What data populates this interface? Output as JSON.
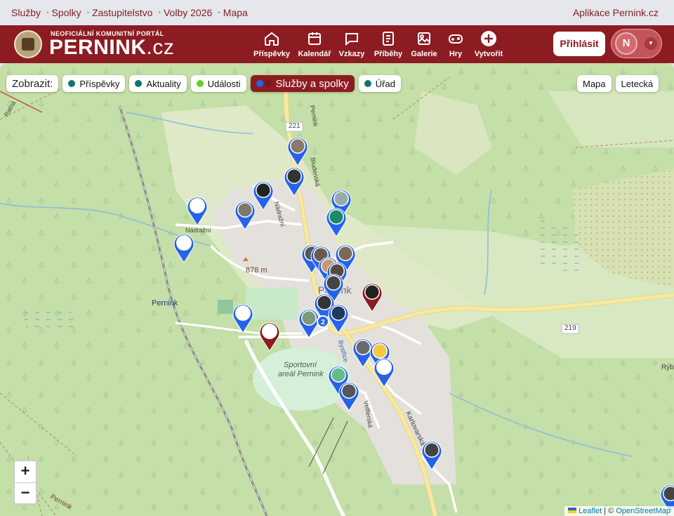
{
  "topnav": {
    "items": [
      "Služby",
      "Spolky",
      "Zastupitelstvo",
      "Volby 2026",
      "Mapa"
    ],
    "app_link": "Aplikace Pernink.cz"
  },
  "header": {
    "logo_sub": "NEOFICIÁLNÍ KOMUNITNÍ PORTÁL",
    "logo_name": "PERNINK",
    "logo_tld": ".cz",
    "nav": [
      {
        "label": "Příspěvky",
        "icon": "home-icon"
      },
      {
        "label": "Kalendář",
        "icon": "calendar-icon"
      },
      {
        "label": "Vzkazy",
        "icon": "chat-bubble-icon"
      },
      {
        "label": "Příběhy",
        "icon": "book-icon"
      },
      {
        "label": "Galerie",
        "icon": "image-icon"
      },
      {
        "label": "Hry",
        "icon": "gamepad-icon"
      },
      {
        "label": "Vytvořit",
        "icon": "plus-circle-icon"
      }
    ],
    "login_label": "Přihlásit",
    "user_initial": "N"
  },
  "map": {
    "show_label": "Zobrazit:",
    "filters": [
      {
        "label": "Příspěvky",
        "color": "#0f766e",
        "active": false
      },
      {
        "label": "Aktuality",
        "color": "#0f766e",
        "active": false
      },
      {
        "label": "Události",
        "color": "#65d11f",
        "active": false
      },
      {
        "label": "Služby a spolky",
        "colors": [
          "#2563eb",
          "#8c1c22"
        ],
        "active": true
      },
      {
        "label": "Úřad",
        "color": "#0f766e",
        "active": false
      }
    ],
    "map_types": [
      "Mapa",
      "Letecká"
    ],
    "zoom_in": "+",
    "zoom_out": "−",
    "labels": {
      "road_221": "221",
      "road_219": "219",
      "elevation": "878 m",
      "village": "Pernink",
      "station": "Pernink",
      "sports": "Sportovní",
      "sports2": "areál Pernink",
      "forest": "Pernink",
      "nadrazni": "Nádražní",
      "nadrazni2": "Nádražní",
      "bludenska": "Bludenská",
      "pernink_n": "Pernink",
      "karlovarska": "Karlovarská",
      "verlenska": "Velflerská",
      "bystrice": "Bystřice",
      "cluster_count": "2",
      "kamena": "Rýb",
      "radiata": "Ratná"
    },
    "attribution": {
      "leaflet": "Leaflet",
      "sep": "|",
      "copy": "©",
      "osm": "OpenStreetMap"
    }
  }
}
